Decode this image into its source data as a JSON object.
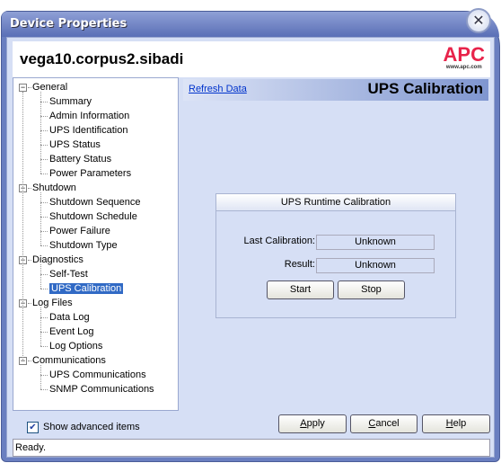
{
  "window": {
    "title": "Device Properties",
    "close_icon": "close-icon"
  },
  "header": {
    "host": "vega10.corpus2.sibadi",
    "logo": "APC",
    "logo_url": "www.apc.com",
    "logo_color": "#e8234a"
  },
  "tree": [
    {
      "label": "General",
      "level": 0
    },
    {
      "label": "Summary",
      "level": 1
    },
    {
      "label": "Admin Information",
      "level": 1
    },
    {
      "label": "UPS Identification",
      "level": 1
    },
    {
      "label": "UPS Status",
      "level": 1
    },
    {
      "label": "Battery Status",
      "level": 1
    },
    {
      "label": "Power Parameters",
      "level": 1
    },
    {
      "label": "Shutdown",
      "level": 0
    },
    {
      "label": "Shutdown Sequence",
      "level": 1
    },
    {
      "label": "Shutdown Schedule",
      "level": 1
    },
    {
      "label": "Power Failure",
      "level": 1
    },
    {
      "label": "Shutdown Type",
      "level": 1
    },
    {
      "label": "Diagnostics",
      "level": 0
    },
    {
      "label": "Self-Test",
      "level": 1
    },
    {
      "label": "UPS Calibration",
      "level": 1,
      "selected": true
    },
    {
      "label": "Log Files",
      "level": 0
    },
    {
      "label": "Data Log",
      "level": 1
    },
    {
      "label": "Event Log",
      "level": 1
    },
    {
      "label": "Log Options",
      "level": 1
    },
    {
      "label": "Communications",
      "level": 0
    },
    {
      "label": "UPS Communications",
      "level": 1
    },
    {
      "label": "SNMP Communications",
      "level": 1
    }
  ],
  "main": {
    "refresh": "Refresh Data",
    "title": "UPS Calibration",
    "group": {
      "title": "UPS Runtime Calibration",
      "last_label": "Last Calibration:",
      "last_value": "Unknown",
      "result_label": "Result:",
      "result_value": "Unknown",
      "start": "Start",
      "stop": "Stop"
    }
  },
  "footer": {
    "show_advanced": "Show advanced items",
    "show_advanced_checked": true,
    "apply": "Apply",
    "cancel": "Cancel",
    "help": "Help",
    "status": "Ready."
  }
}
